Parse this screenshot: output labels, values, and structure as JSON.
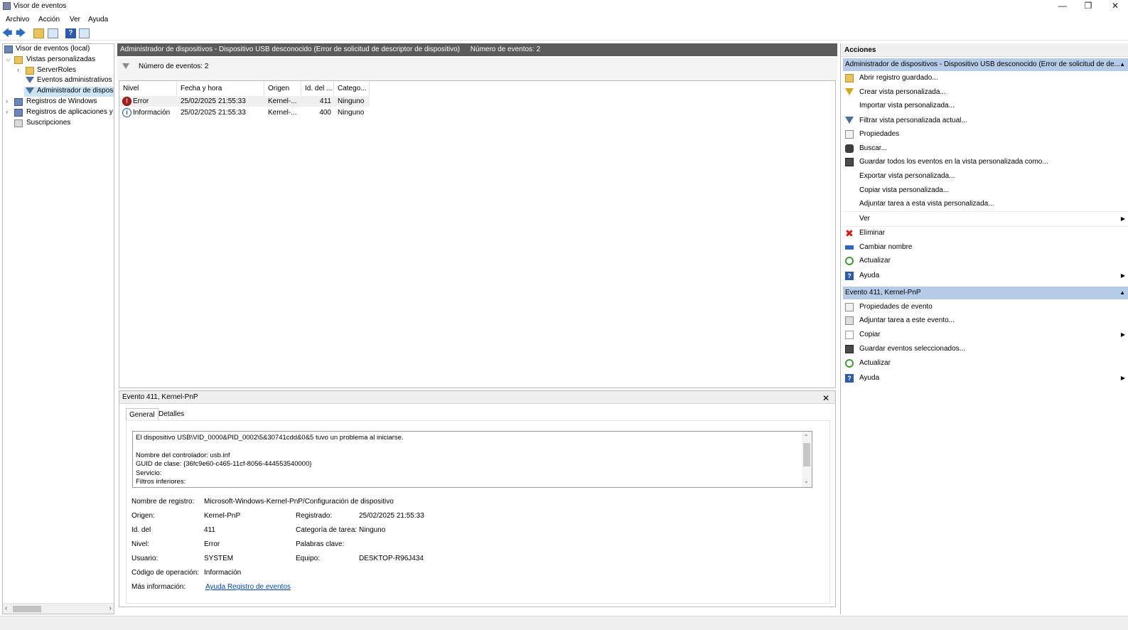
{
  "window": {
    "title": "Visor de eventos",
    "minimize_glyph": "—",
    "maximize_glyph": "❐",
    "close_glyph": "✕"
  },
  "menu": [
    "Archivo",
    "Acción",
    "Ver",
    "Ayuda"
  ],
  "toolbar": {
    "back": "🡄",
    "forward": "🡆",
    "help": "?"
  },
  "tree": {
    "items": [
      {
        "label": "Visor de eventos (local)",
        "icon": "event-viewer-icon"
      },
      {
        "label": "Vistas personalizadas",
        "icon": "folder-icon",
        "chevron": "⌵"
      },
      {
        "label": "ServerRoles",
        "icon": "folder-icon",
        "chevron": "›"
      },
      {
        "label": "Eventos administrativos",
        "icon": "filter-icon"
      },
      {
        "label": "Administrador de dispositivos - Dispositivo USB desconocido",
        "icon": "filter-icon"
      },
      {
        "label": "Registros de Windows",
        "icon": "log-icon",
        "chevron": "›"
      },
      {
        "label": "Registros de aplicaciones y servicios",
        "icon": "log-icon",
        "chevron": "›"
      },
      {
        "label": "Suscripciones",
        "icon": "subscription-icon"
      }
    ],
    "scroll_left": "‹",
    "scroll_right": "›"
  },
  "center": {
    "header_title": "Administrador de dispositivos - Dispositivo USB desconocido (Error de solicitud de descriptor de dispositivo)",
    "header_count": "Número de eventos: 2",
    "filter_text": "Número de eventos: 2",
    "columns": [
      "Nivel",
      "Fecha y hora",
      "Origen",
      "Id. del ...",
      "Catego..."
    ],
    "rows": [
      {
        "level": "Error",
        "level_glyph": "!",
        "datetime": "25/02/2025 21:55:33",
        "source": "Kernel-...",
        "id": "411",
        "category": "Ninguno"
      },
      {
        "level": "Información",
        "level_glyph": "i",
        "datetime": "25/02/2025 21:55:33",
        "source": "Kernel-...",
        "id": "400",
        "category": "Ninguno"
      }
    ]
  },
  "detail": {
    "title": "Evento 411, Kernel-PnP",
    "close_glyph": "✕",
    "tabs": [
      "General",
      "Detalles"
    ],
    "description_lines": [
      "El dispositivo USB\\VID_0000&PID_0002\\5&30741cdd&0&5 tuvo un problema al iniciarse.",
      "",
      "Nombre del controlador: usb.inf",
      "GUID de clase: {36fc9e60-c465-11cf-8056-444553540000}",
      "Servicio:",
      "Filtros inferiores:"
    ],
    "scroll_up": "⌃",
    "scroll_down": "⌄",
    "props": {
      "log_name_label": "Nombre de registro:",
      "log_name_value": "Microsoft-Windows-Kernel-PnP/Configuración de dispositivo",
      "source_label": "Origen:",
      "source_value": "Kernel-PnP",
      "logged_label": "Registrado:",
      "logged_value": "25/02/2025 21:55:33",
      "event_id_label": "Id. del",
      "event_id_value": "411",
      "task_label": "Categoría de tarea:",
      "task_value": "Ninguno",
      "level_label": "Nivel:",
      "level_value": "Error",
      "keywords_label": "Palabras clave:",
      "user_label": "Usuario:",
      "user_value": "SYSTEM",
      "computer_label": "Equipo:",
      "computer_value": "DESKTOP-R96J434",
      "opcode_label": "Código de operación:",
      "opcode_value": "Información",
      "more_info_label": "Más información:",
      "more_info_link": "Ayuda Registro de eventos"
    }
  },
  "actions": {
    "title": "Acciones",
    "section1_title": "Administrador de dispositivos - Dispositivo USB desconocido (Error de solicitud de de...",
    "section1_items": [
      {
        "label": "Abrir registro guardado...",
        "icon": "open-log-icon"
      },
      {
        "label": "Crear vista personalizada...",
        "icon": "create-view-icon"
      },
      {
        "label": "Importar vista personalizada...",
        "icon": ""
      },
      {
        "label": "Filtrar vista personalizada actual...",
        "icon": "filter-icon"
      },
      {
        "label": "Propiedades",
        "icon": "properties-icon"
      },
      {
        "label": "Buscar...",
        "icon": "binoculars-icon"
      },
      {
        "label": "Guardar todos los eventos en la vista personalizada como...",
        "icon": "save-icon"
      },
      {
        "label": "Exportar vista personalizada...",
        "icon": ""
      },
      {
        "label": "Copiar vista personalizada...",
        "icon": ""
      },
      {
        "label": "Adjuntar tarea a esta vista personalizada...",
        "icon": ""
      },
      {
        "label": "Ver",
        "icon": "",
        "submenu": "▶"
      },
      {
        "label": "Eliminar",
        "icon": "delete-icon"
      },
      {
        "label": "Cambiar nombre",
        "icon": "rename-icon"
      },
      {
        "label": "Actualizar",
        "icon": "refresh-icon"
      },
      {
        "label": "Ayuda",
        "icon": "help-icon",
        "submenu": "▶"
      }
    ],
    "section2_title": "Evento 411, Kernel-PnP",
    "section2_items": [
      {
        "label": "Propiedades de evento",
        "icon": "event-properties-icon"
      },
      {
        "label": "Adjuntar tarea a este evento...",
        "icon": "attach-task-icon"
      },
      {
        "label": "Copiar",
        "icon": "copy-icon",
        "submenu": "▶"
      },
      {
        "label": "Guardar eventos seleccionados...",
        "icon": "save-icon"
      },
      {
        "label": "Actualizar",
        "icon": "refresh-icon"
      },
      {
        "label": "Ayuda",
        "icon": "help-icon",
        "submenu": "▶"
      }
    ],
    "collapse_glyph": "▲",
    "delete_glyph": "✖",
    "help_glyph": "?"
  }
}
